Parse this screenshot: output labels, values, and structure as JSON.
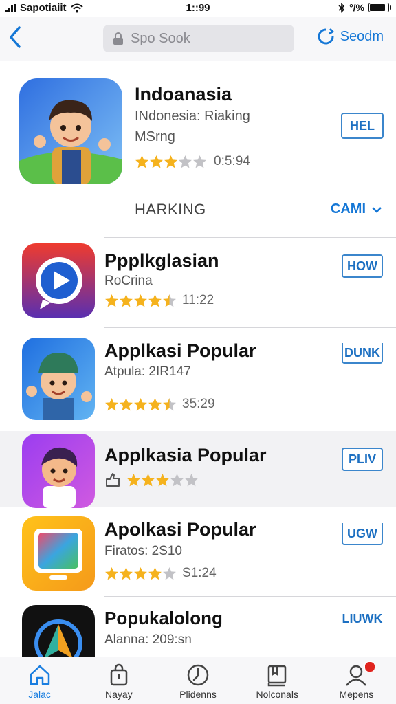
{
  "status": {
    "carrier": "Sapotiaiit",
    "time": "1::99",
    "battery_text": "°/%",
    "battery_level": 0.9
  },
  "nav": {
    "back_icon": "chevron-left-icon",
    "search_placeholder": "Spo Sook",
    "right_label": "Seodm"
  },
  "featured": {
    "title": "Indoanasia",
    "subtitle": "INdonesia: Riaking",
    "subtitle2": "MSrng",
    "rating_stars": 3,
    "rating_text": "0:5:94",
    "button": "HEL"
  },
  "section": {
    "label": "HARKING",
    "action": "CAMI"
  },
  "apps": [
    {
      "title": "Ppplkglasian",
      "subtitle": "RoCrina",
      "stars": 4.5,
      "rating_text": "11:22",
      "button": "HOW"
    },
    {
      "title": "Applkasi Popular",
      "subtitle": "Atpula: 2IR147",
      "stars": 4.5,
      "rating_text": "35:29",
      "button": "DUNK"
    },
    {
      "title": "Applkasia Popular",
      "subtitle": "",
      "stars": 3,
      "rating_text": "",
      "button": "PLIV"
    },
    {
      "title": "Apolkasi Popular",
      "subtitle": "Firatos: 2S10",
      "stars": 4,
      "rating_text": "S1:24",
      "button": "UGW"
    },
    {
      "title": "Popukalolong",
      "subtitle": "Alanna: 209:sn",
      "stars": 0,
      "rating_text": "",
      "button": "LIUWK"
    }
  ],
  "tabs": [
    {
      "label": "Jalac",
      "icon": "home-icon",
      "active": true
    },
    {
      "label": "Nayay",
      "icon": "shopping-bag-icon",
      "active": false
    },
    {
      "label": "Plidenns",
      "icon": "clock-icon",
      "active": false
    },
    {
      "label": "Nolconals",
      "icon": "book-icon",
      "active": false
    },
    {
      "label": "Mepens",
      "icon": "person-icon",
      "active": false,
      "badge": true
    }
  ],
  "colors": {
    "accent": "#1577d6",
    "star": "#f5b21d",
    "star_empty": "#c2c2c6",
    "badge": "#e0241f"
  }
}
